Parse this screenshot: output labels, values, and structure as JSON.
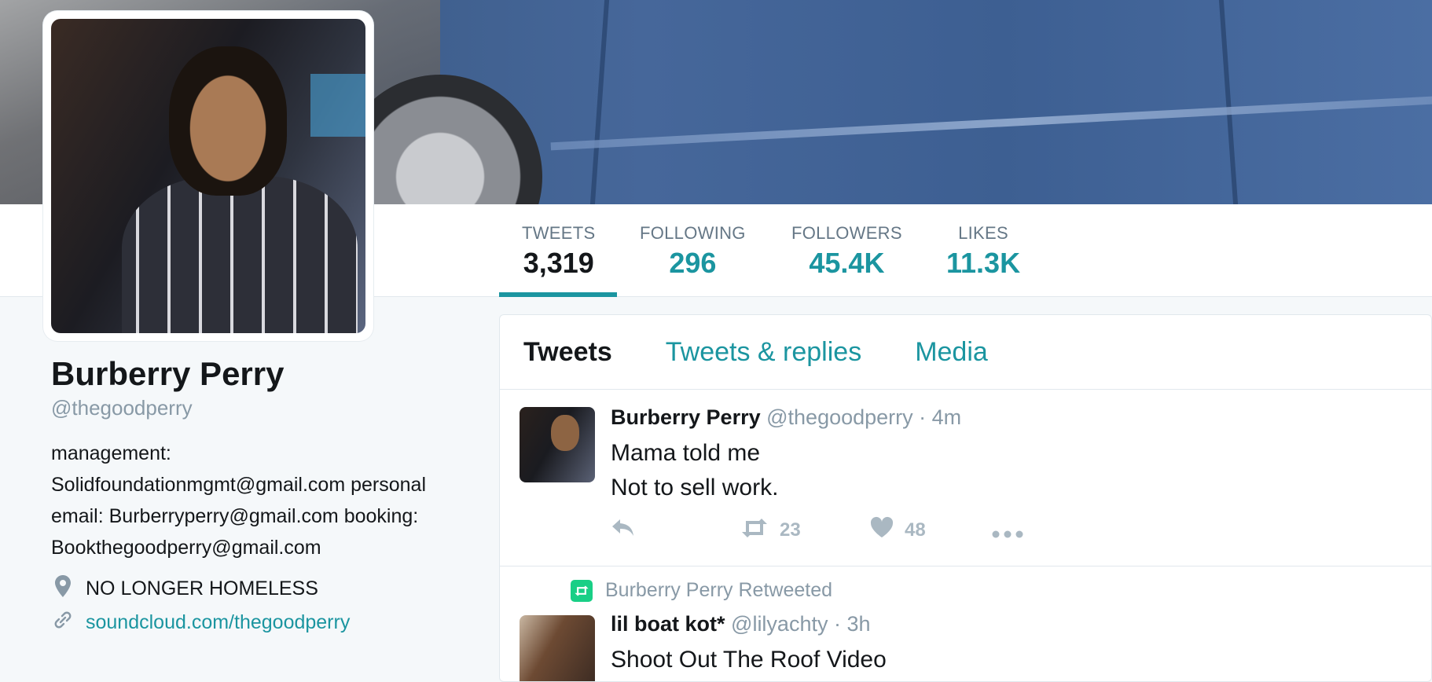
{
  "stats": [
    {
      "label": "TWEETS",
      "value": "3,319"
    },
    {
      "label": "FOLLOWING",
      "value": "296"
    },
    {
      "label": "FOLLOWERS",
      "value": "45.4K"
    },
    {
      "label": "LIKES",
      "value": "11.3K"
    }
  ],
  "profile": {
    "name": "Burberry Perry",
    "handle": "@thegoodperry",
    "bio": "management: Solidfoundationmgmt@gmail.com personal email: Burberryperry@gmail.com booking: Bookthegoodperry@gmail.com",
    "location": "NO LONGER HOMELESS",
    "website": "soundcloud.com/thegoodperry"
  },
  "tabs": [
    "Tweets",
    "Tweets & replies",
    "Media"
  ],
  "tweets": [
    {
      "fullname": "Burberry Perry",
      "username": "@thegoodperry",
      "time": "· 4m",
      "line1": "Mama told me",
      "line2": "Not to sell work.",
      "retweets": "23",
      "likes": "48"
    },
    {
      "context": "Burberry Perry Retweeted",
      "fullname": "lil boat kot*",
      "username": "@lilyachty",
      "time": "· 3h",
      "line1": "Shoot Out The Roof Video"
    }
  ],
  "colors": {
    "accent": "#1b95a0",
    "retweet": "#19cf86",
    "muted": "#8899a6"
  }
}
